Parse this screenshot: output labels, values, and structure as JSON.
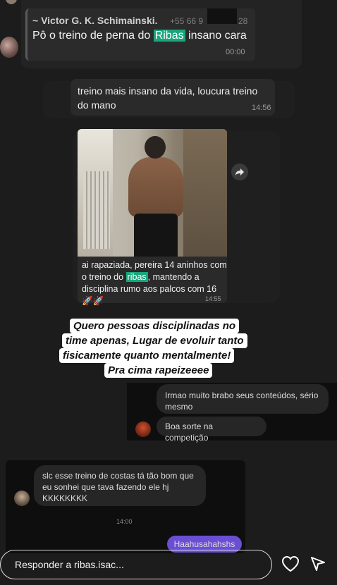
{
  "message1": {
    "author": "~ Victor G. K. Schimainski.",
    "phone": "+55 66 9",
    "phone_suffix": "28",
    "text_before": "Pô o treino de perna do ",
    "highlight": "Ribas",
    "text_after": " insano cara",
    "time": "00:00"
  },
  "message2": {
    "text": "treino mais insano da vida, loucura treino do mano",
    "time": "14:56"
  },
  "message3": {
    "caption_before": "ai rapaziada, pereira 14 aninhos com o treino do ",
    "caption_highlight": "ribas",
    "caption_after": ", mantendo a disciplina rumo aos palcos com 16 🚀🚀",
    "time": "14:55"
  },
  "story_caption": {
    "line1": "Quero pessoas disciplinadas no",
    "line2": "time apenas, Lugar de evoluir tanto",
    "line3": "fisicamente quanto mentalmente!",
    "line4": "Pra cima rapeizeeee"
  },
  "dm1": {
    "msg1": "Irmao muito brabo seus conteúdos, sério mesmo",
    "msg2": "Boa sorte na competição"
  },
  "dm2": {
    "msg": "slc esse treino de costas tá tão bom que eu sonhei que tava fazendo ele hj KKKKKKKK",
    "time": "14:00",
    "sent": "Haahusahahshs"
  },
  "footer": {
    "reply_placeholder": "Responder a ribas.isac..."
  },
  "colors": {
    "highlight": "#1aa67c",
    "sent_bubble": "#6a4fd4"
  }
}
